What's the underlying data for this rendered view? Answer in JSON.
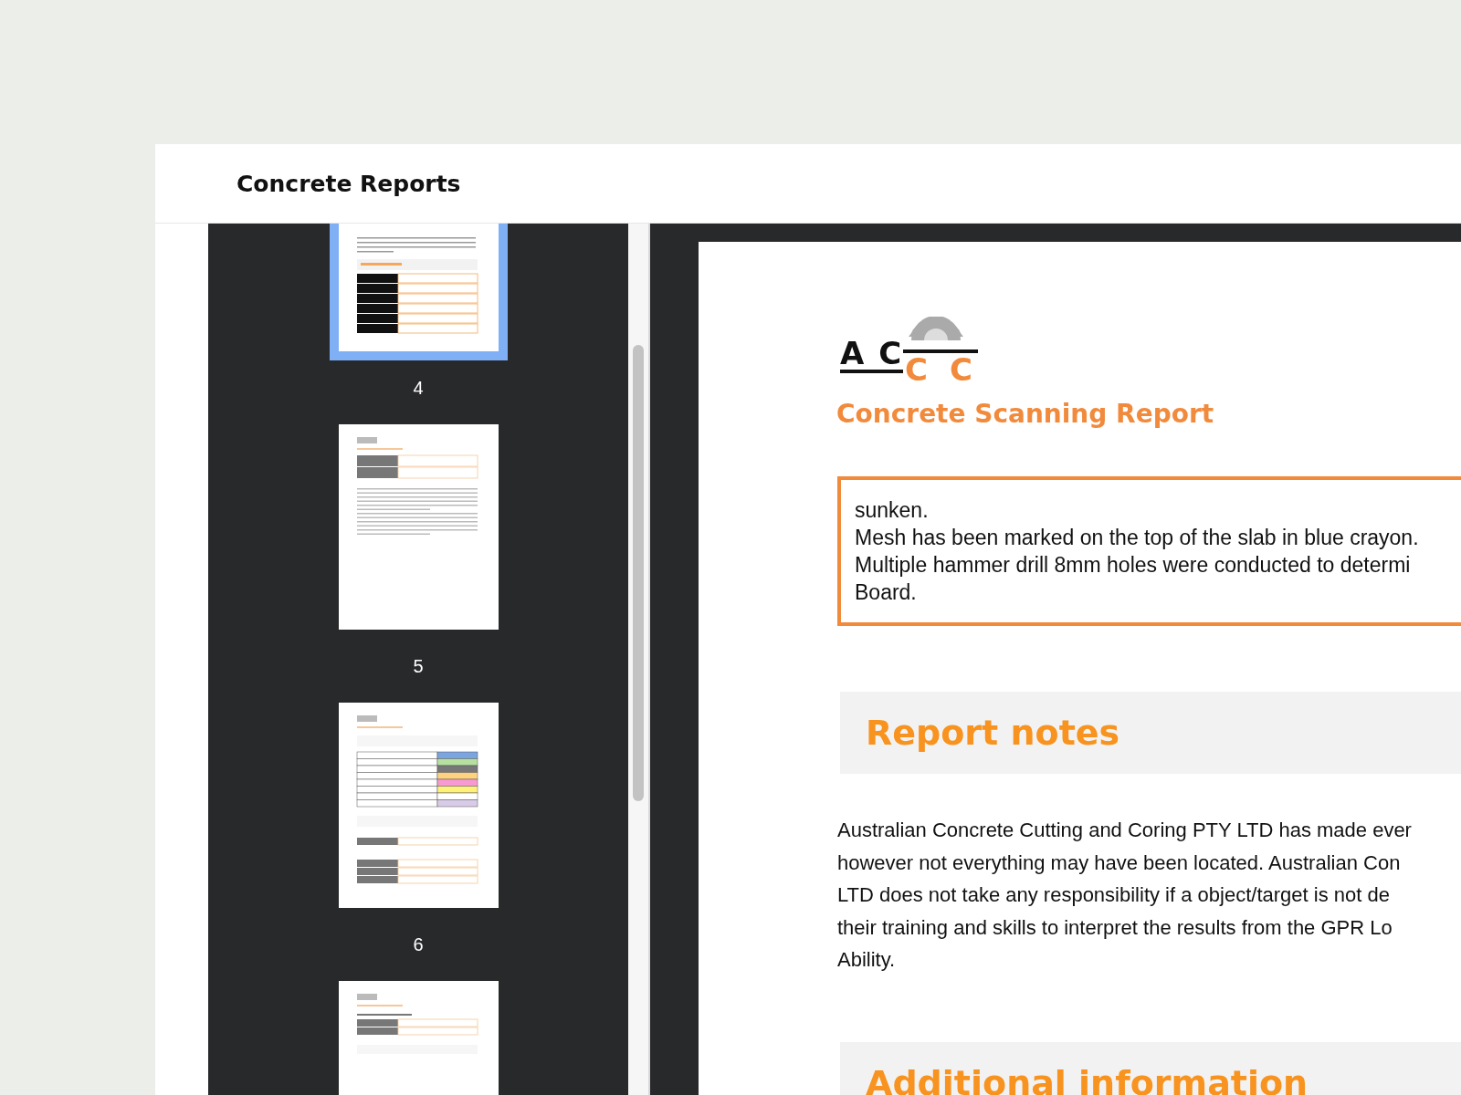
{
  "header": {
    "title": "Concrete Reports"
  },
  "thumbnails": [
    {
      "page": "4",
      "kind": "info-table",
      "selected": true
    },
    {
      "page": "5",
      "kind": "disclaimer",
      "selected": false
    },
    {
      "page": "6",
      "kind": "legend",
      "selected": false
    },
    {
      "kind": "images",
      "selected": false
    }
  ],
  "document": {
    "logo": {
      "left": "A C",
      "right": "C C"
    },
    "title": "Concrete Scanning Report",
    "notes_box": {
      "lines": [
        "sunken.",
        "Mesh has been marked on the top of the slab in blue crayon.",
        "Multiple hammer drill 8mm holes were conducted to determi",
        "Board."
      ]
    },
    "sections": [
      {
        "heading": "Report notes",
        "lines": [
          "Australian Concrete Cutting and Coring PTY LTD has made ever",
          "however not everything may have been located. Australian Con",
          "LTD does not take any responsibility if a object/target is not de",
          "their training and skills to interpret the results from the GPR Lo",
          "Ability."
        ]
      },
      {
        "heading": "Additional information"
      }
    ]
  }
}
